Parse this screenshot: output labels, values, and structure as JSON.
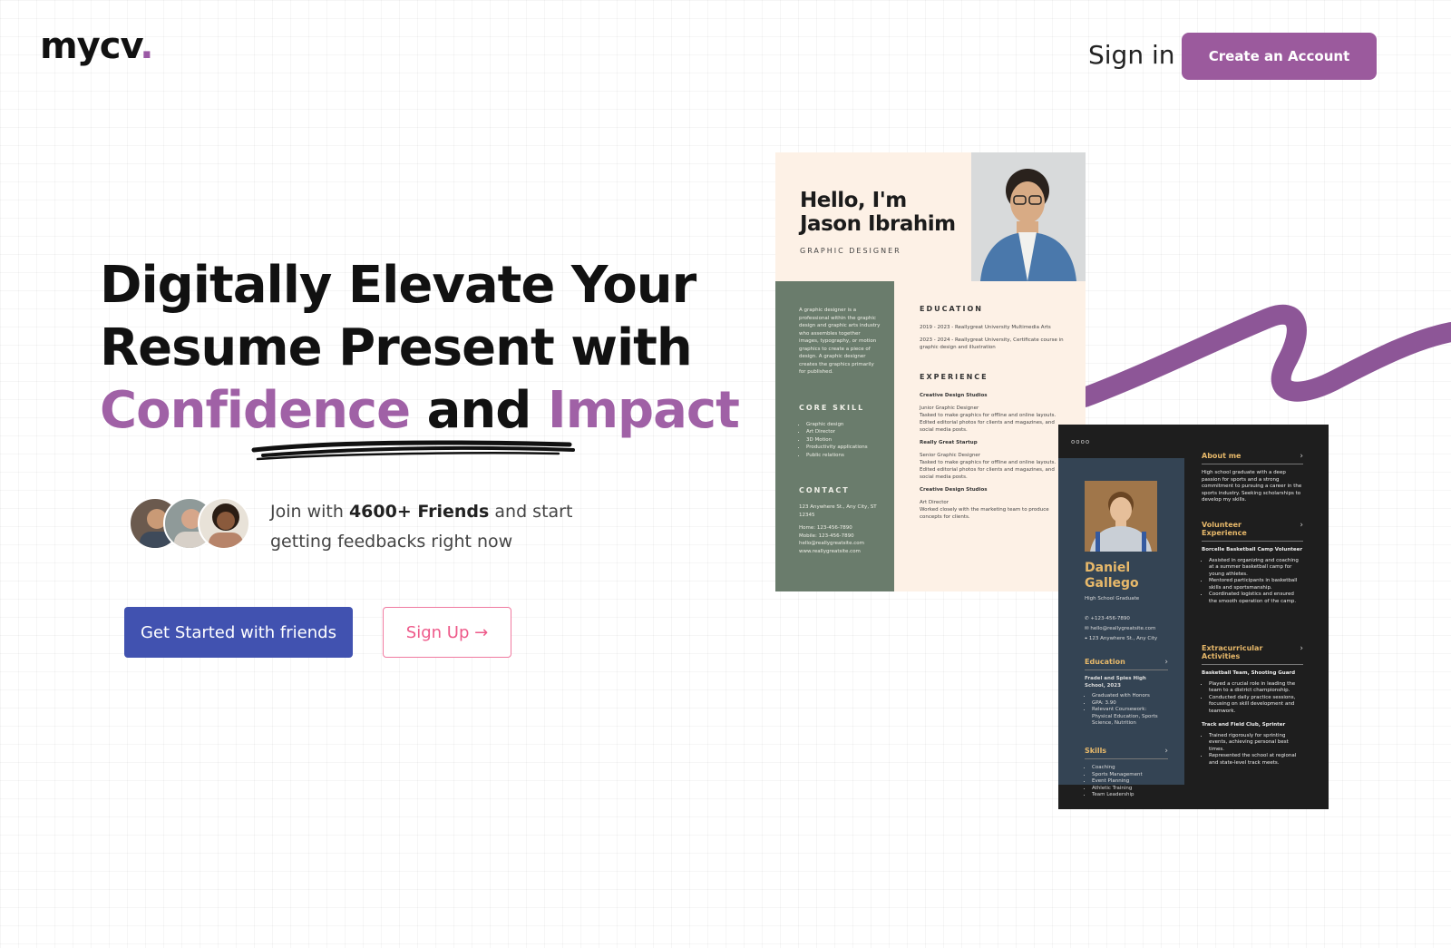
{
  "brand": {
    "name": "mycv",
    "dot": "."
  },
  "header": {
    "signin_label": "Sign in",
    "create_account_label": "Create an Account"
  },
  "hero": {
    "line1": "Digitally Elevate Your",
    "line2": "Resume Present with",
    "accent1": "Confidence",
    "connector": "and",
    "accent2": "Impact",
    "join_prefix": "Join with",
    "join_bold": "4600+ Friends",
    "join_suffix": "and start getting feedbacks right now",
    "primary_cta": "Get Started with friends",
    "secondary_cta": "Sign Up"
  },
  "colors": {
    "accent": "#9b5a9d",
    "primary_button": "#4152b0",
    "secondary_button": "#ee5a8a"
  },
  "resume1": {
    "greeting": "Hello, I'm",
    "name": "Jason Ibrahim",
    "role": "GRAPHIC DESIGNER",
    "summary": "A graphic designer is a professional within the graphic design and graphic arts industry who assembles together images, typography, or motion graphics to create a piece of design. A graphic designer creates the graphics primarily for published.",
    "core_skill_title": "CORE SKILL",
    "skills": [
      "Graphic design",
      "Art Director",
      "3D Motion",
      "Productivity applications",
      "Public relations"
    ],
    "contact_title": "CONTACT",
    "contact": [
      "123 Anywhere St., Any City, ST 12345",
      "Home: 123-456-7890",
      "Mobile: 123-456-7890",
      "hello@reallygreatsite.com",
      "www.reallygreatsite.com"
    ],
    "education_title": "EDUCATION",
    "education": [
      "2019 - 2023 - Reallygreat University Multimedia Arts",
      "2023 - 2024 - Reallygreat University, Certificate course in graphic design and illustration"
    ],
    "experience_title": "EXPERIENCE",
    "experience": [
      {
        "company": "Creative Design Studios",
        "role": "Junior Graphic Designer",
        "bullets": [
          "Tasked to make graphics for offline and online layouts.",
          "Edited editorial photos for clients and magazines, and social media posts."
        ]
      },
      {
        "company": "Really Great Startup",
        "role": "Senior Graphic Designer",
        "bullets": [
          "Tasked to make graphics for offline and online layouts.",
          "Edited editorial photos for clients and magazines, and social media posts."
        ]
      },
      {
        "company": "Creative Design Studios",
        "role": "Art Director",
        "bullets": [
          "Worked closely with the marketing team to produce concepts for clients."
        ]
      }
    ]
  },
  "resume2": {
    "dots": "oooo",
    "first_name": "Daniel",
    "last_name": "Gallego",
    "subtitle": "High School Graduate",
    "contact": [
      "+123-456-7890",
      "hello@reallygreatsite.com",
      "123 Anywhere St., Any City"
    ],
    "education_title": "Education",
    "school": "Fradel and Spies High School, 2023",
    "education": [
      "Graduated with Honors",
      "GPA: 3.90",
      "Relevant Coursework: Physical Education, Sports Science, Nutrition"
    ],
    "skills_title": "Skills",
    "skills": [
      "Coaching",
      "Sports Management",
      "Event Planning",
      "Athletic Training",
      "Team Leadership"
    ],
    "about_title": "About me",
    "about": "High school graduate with a deep passion for sports and a strong commitment to pursuing a career in the sports industry. Seeking scholarships to develop my skills.",
    "volunteer_title": "Volunteer Experience",
    "volunteer_role": "Borcelle Basketball Camp Volunteer",
    "volunteer": [
      "Assisted in organizing and coaching at a summer basketball camp for young athletes.",
      "Mentored participants in basketball skills and sportsmanship.",
      "Coordinated logistics and ensured the smooth operation of the camp."
    ],
    "extra_title": "Extracurricular Activities",
    "extra1_role": "Basketball Team, Shooting Guard",
    "extra1": [
      "Played a crucial role in leading the team to a district championship.",
      "Conducted daily practice sessions, focusing on skill development and teamwork."
    ],
    "extra2_role": "Track and Field Club, Sprinter",
    "extra2": [
      "Trained rigorously for sprinting events, achieving personal best times.",
      "Represented the school at regional and state-level track meets."
    ]
  }
}
